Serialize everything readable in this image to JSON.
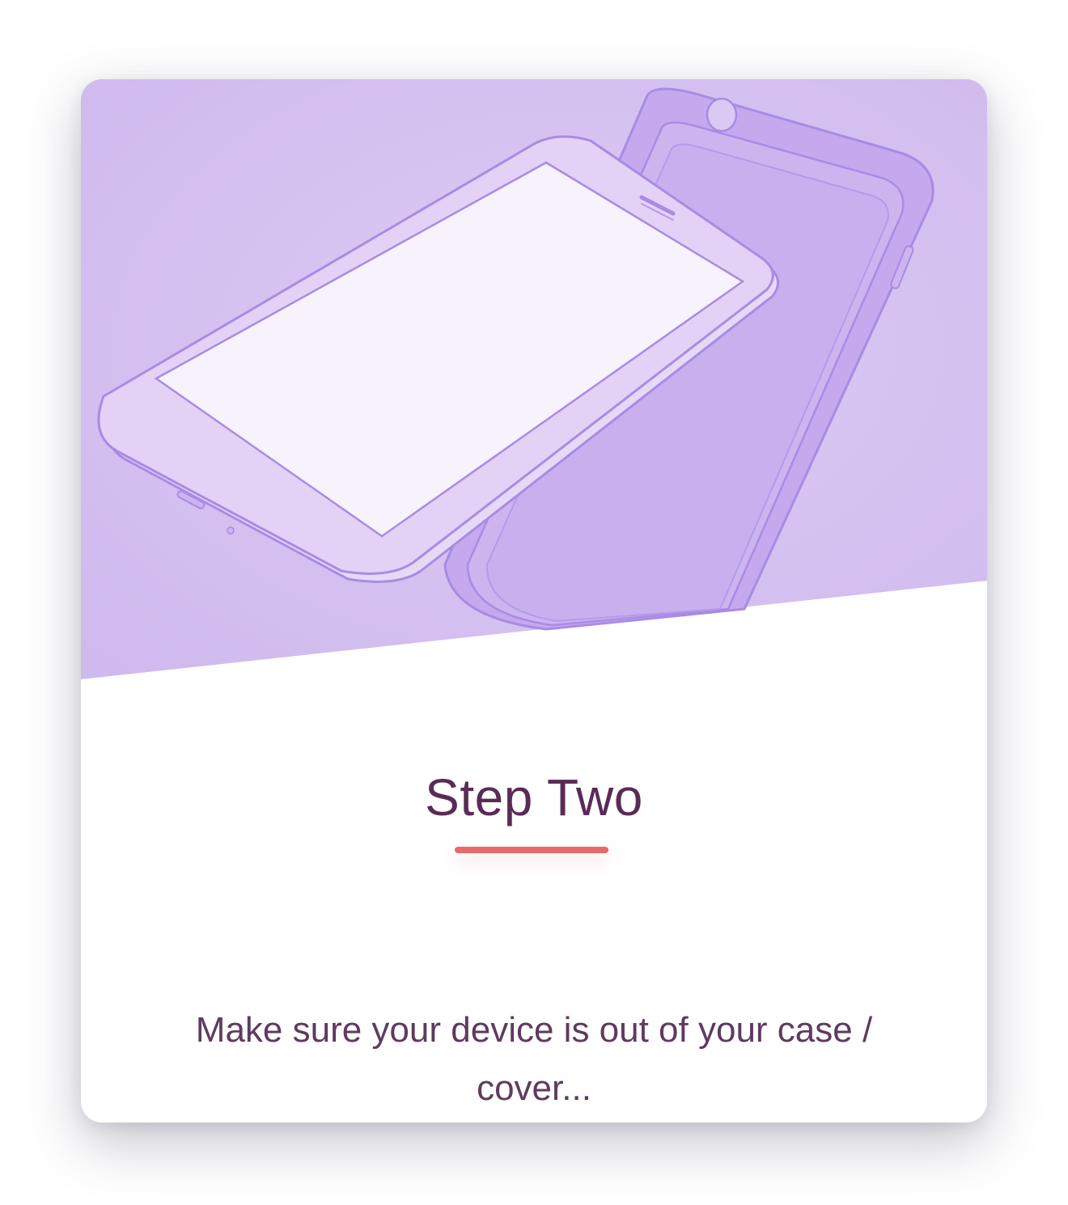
{
  "step": {
    "title": "Step Two",
    "description": "Make sure your device is out of your case / cover..."
  },
  "colors": {
    "hero_background": "#d8c6f1",
    "title_text": "#5a2b57",
    "description_text": "#5f3a5e",
    "accent_underline": "#e7696a",
    "outline": "#a98be4"
  },
  "illustration": {
    "phone_icon": "smartphone-icon",
    "case_icon": "phone-case-icon"
  }
}
